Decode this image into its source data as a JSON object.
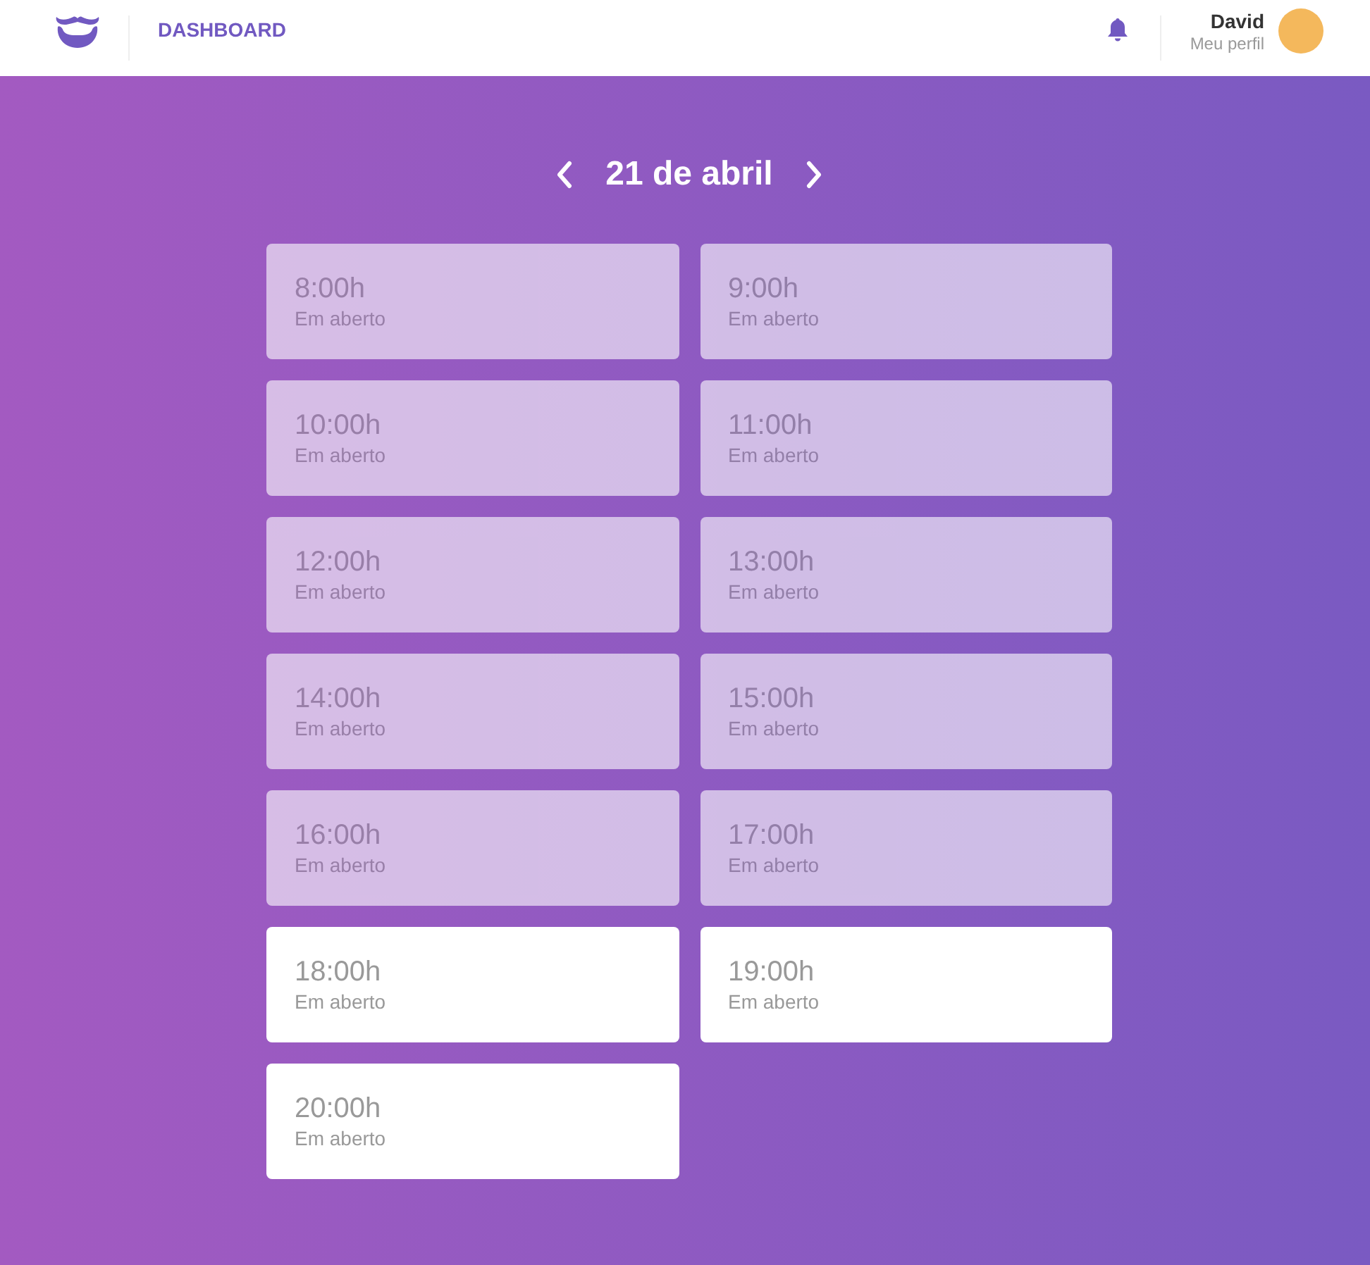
{
  "header": {
    "nav_link": "DASHBOARD",
    "user": {
      "name": "David",
      "profile_link": "Meu perfil"
    }
  },
  "date_nav": {
    "title": "21 de abril"
  },
  "slots": [
    {
      "time": "8:00h",
      "status": "Em aberto",
      "disabled": true
    },
    {
      "time": "9:00h",
      "status": "Em aberto",
      "disabled": true
    },
    {
      "time": "10:00h",
      "status": "Em aberto",
      "disabled": true
    },
    {
      "time": "11:00h",
      "status": "Em aberto",
      "disabled": true
    },
    {
      "time": "12:00h",
      "status": "Em aberto",
      "disabled": true
    },
    {
      "time": "13:00h",
      "status": "Em aberto",
      "disabled": true
    },
    {
      "time": "14:00h",
      "status": "Em aberto",
      "disabled": true
    },
    {
      "time": "15:00h",
      "status": "Em aberto",
      "disabled": true
    },
    {
      "time": "16:00h",
      "status": "Em aberto",
      "disabled": true
    },
    {
      "time": "17:00h",
      "status": "Em aberto",
      "disabled": true
    },
    {
      "time": "18:00h",
      "status": "Em aberto",
      "disabled": false
    },
    {
      "time": "19:00h",
      "status": "Em aberto",
      "disabled": false
    },
    {
      "time": "20:00h",
      "status": "Em aberto",
      "disabled": false
    }
  ]
}
